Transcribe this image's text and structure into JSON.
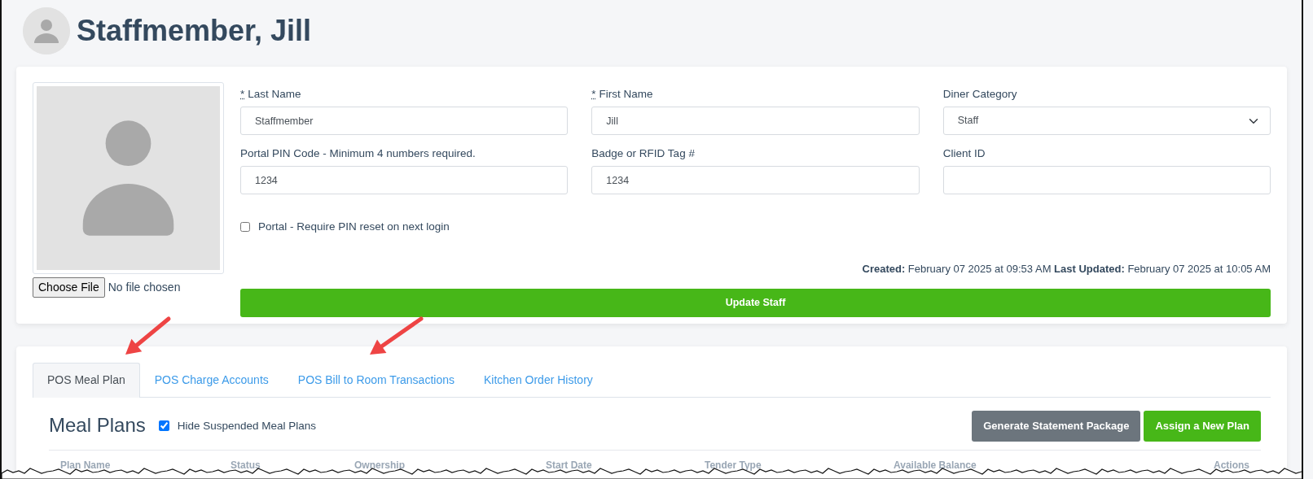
{
  "header": {
    "title": "Staffmember, Jill"
  },
  "photo": {
    "choose_button": "Choose File",
    "file_status": "No file chosen"
  },
  "fields": [
    {
      "kind": "text",
      "required_mark": "*",
      "label": "Last Name",
      "value": "Staffmember"
    },
    {
      "kind": "text",
      "required_mark": "*",
      "label": "First Name",
      "value": "Jill"
    },
    {
      "kind": "select",
      "label": "Diner Category",
      "value": "Staff"
    },
    {
      "kind": "text",
      "label": "Portal PIN Code - Minimum 4 numbers required.",
      "value": "1234"
    },
    {
      "kind": "text",
      "label": "Badge or RFID Tag #",
      "value": "1234"
    },
    {
      "kind": "text",
      "label": "Client ID"
    }
  ],
  "pin_reset": {
    "label": "Portal - Require PIN reset on next login",
    "checked": false
  },
  "timestamps": "**Created:** February 07 2025 at 09:53 AM **Last Updated:** February 07 2025 at 10:05 AM",
  "update_button": "Update Staff",
  "tabs": [
    {
      "label": "POS Meal Plan",
      "selected": true
    },
    {
      "label": "POS Charge Accounts",
      "selected": false
    },
    {
      "label": "POS Bill to Room Transactions",
      "selected": false
    },
    {
      "label": "Kitchen Order History",
      "selected": false
    }
  ],
  "annotations": [
    {
      "kind": "arrow"
    },
    {
      "kind": "arrow"
    }
  ],
  "meal_plans": {
    "title": "Meal Plans",
    "hide_suspended": {
      "label": "Hide Suspended Meal Plans",
      "checked": true
    },
    "buttons": [
      {
        "kind": "secondary",
        "label": "Generate Statement Package"
      },
      {
        "kind": "success",
        "label": "Assign a New Plan"
      }
    ],
    "columns": [
      "Plan Name",
      "Status",
      "Ownership",
      "Start Date",
      "Tender Type",
      "Available Balance",
      "Actions"
    ]
  }
}
